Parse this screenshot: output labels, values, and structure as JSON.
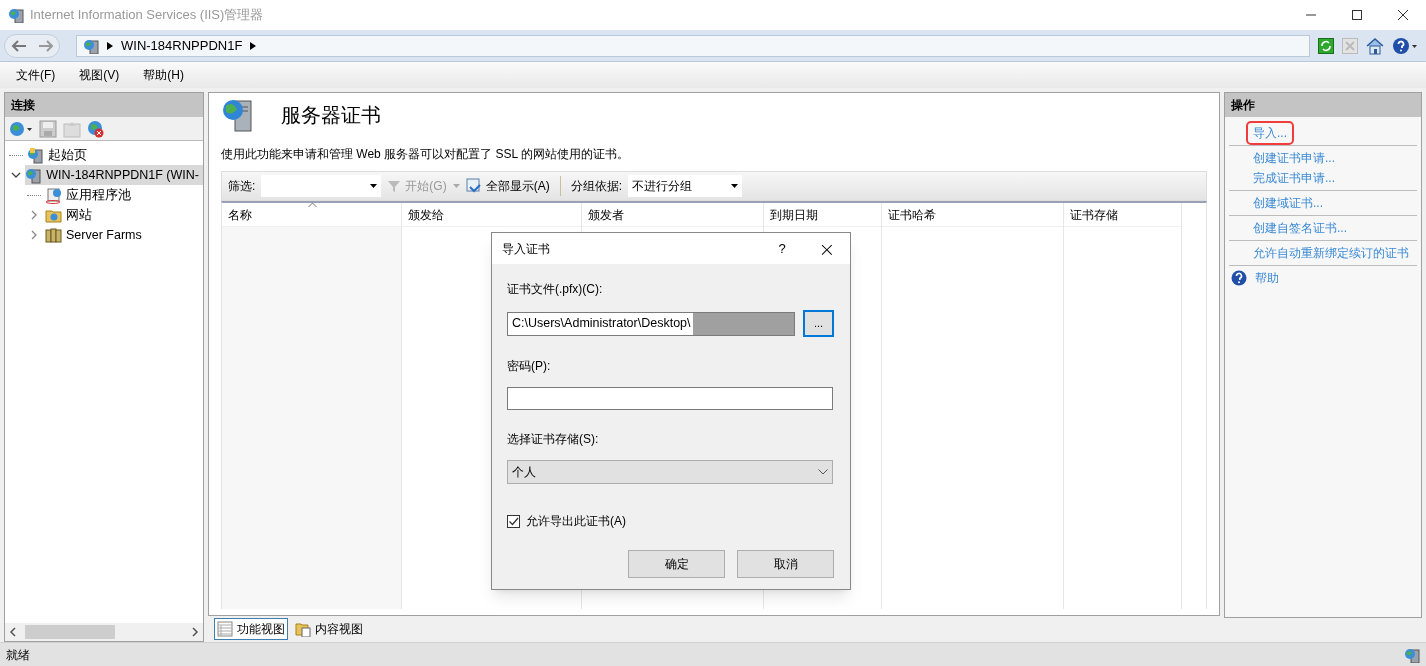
{
  "window": {
    "title": "Internet Information Services (IIS)管理器"
  },
  "address": {
    "segments": [
      "WIN-184RNPPDN1F"
    ]
  },
  "menu": [
    "文件(F)",
    "视图(V)",
    "帮助(H)"
  ],
  "connections": {
    "title": "连接",
    "tree": [
      {
        "label": "起始页",
        "kind": "start",
        "selected": false
      },
      {
        "label": "WIN-184RNPPDN1F (WIN-",
        "kind": "server",
        "selected": true,
        "expanded": true,
        "children": [
          {
            "label": "应用程序池",
            "kind": "pool",
            "selected": false
          },
          {
            "label": "网站",
            "kind": "sites",
            "selected": false,
            "expanded": false
          },
          {
            "label": "Server Farms",
            "kind": "farms",
            "selected": false,
            "expanded": false
          }
        ]
      }
    ]
  },
  "feature": {
    "title": "服务器证书",
    "description": "使用此功能来申请和管理 Web 服务器可以对配置了 SSL 的网站使用的证书。",
    "toolbar": {
      "filter_label": "筛选:",
      "start": "开始(G)",
      "show_all": "全部显示(A)",
      "group_label": "分组依据:",
      "group_value": "不进行分组"
    },
    "columns": [
      {
        "label": "名称",
        "sorted": true
      },
      {
        "label": "颁发给",
        "sorted": false
      },
      {
        "label": "颁发者",
        "sorted": false
      },
      {
        "label": "到期日期",
        "sorted": false
      },
      {
        "label": "证书哈希",
        "sorted": false
      },
      {
        "label": "证书存储",
        "sorted": false
      }
    ]
  },
  "view_tabs": [
    {
      "label": "功能视图",
      "selected": true
    },
    {
      "label": "内容视图",
      "selected": false
    }
  ],
  "actions": {
    "title": "操作",
    "groups": [
      [
        {
          "label": "导入...",
          "kind": "link",
          "highlighted": true
        }
      ],
      [
        {
          "label": "创建证书申请...",
          "kind": "link",
          "highlighted": false
        },
        {
          "label": "完成证书申请...",
          "kind": "link",
          "highlighted": false
        }
      ],
      [
        {
          "label": "创建域证书...",
          "kind": "link",
          "highlighted": false
        }
      ],
      [
        {
          "label": "创建自签名证书...",
          "kind": "link",
          "highlighted": false
        }
      ],
      [
        {
          "label": "允许自动重新绑定续订的证书",
          "kind": "link",
          "highlighted": false
        }
      ],
      [
        {
          "label": "帮助",
          "kind": "help",
          "highlighted": false
        }
      ]
    ]
  },
  "status_bar": "就绪",
  "dialog": {
    "title": "导入证书",
    "help": "?",
    "close": "×",
    "file_label": "证书文件(.pfx)(C):",
    "file_value": "C:\\Users\\Administrator\\Desktop\\",
    "browse": "...",
    "password_label": "密码(P):",
    "store_label": "选择证书存储(S):",
    "store_value": "个人",
    "export_label": "允许导出此证书(A)",
    "export_checked": true,
    "buttons": [
      "确定",
      "取消"
    ]
  }
}
